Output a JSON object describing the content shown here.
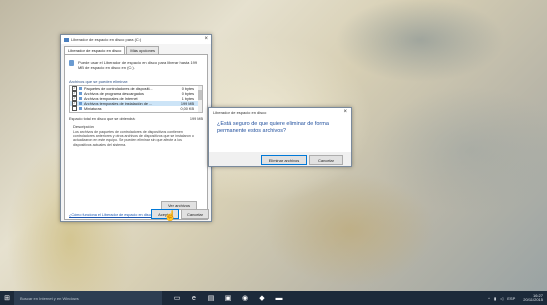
{
  "cleanup_window": {
    "title": "Liberador de espacio en disco para (C:)",
    "tabs": [
      "Liberador de espacio en disco",
      "Más opciones"
    ],
    "drive_text": "Puede usar el Liberador de espacio en disco para liberar hasta 199 MB de espacio en disco en (C:).",
    "section_label": "Archivos que se pueden eliminar:",
    "items": [
      {
        "name": "Paquetes de controladores de dispositi...",
        "size": "0 bytes"
      },
      {
        "name": "Archivos de programa descargados",
        "size": "0 bytes"
      },
      {
        "name": "Archivos temporales de Internet",
        "size": "1 bytes"
      },
      {
        "name": "Archivos temporales de instalación de ...",
        "size": "199 MB"
      },
      {
        "name": "Miniaturas",
        "size": "0,00 KB"
      }
    ],
    "total_label": "Espacio total en disco que se obtendrá:",
    "total_value": "199 MB",
    "desc_title": "Descripción",
    "description": "Los archivos de paquetes de controladores de dispositivos contienen controladores anteriores y otros archivos de dispositivos que se instalaron o actualizaron en este equipo. Se pueden eliminar sin que afecte a los dispositivos actuales del sistema.",
    "view_files_label": "Ver archivos",
    "link": "¿Cómo funciona el Liberador de espacio en disco?",
    "ok_label": "Aceptar",
    "cancel_label": "Cancelar"
  },
  "confirm_dialog": {
    "title": "Liberador de espacio en disco",
    "message": "¿Está seguro de que quiere eliminar de forma permanente estos archivos?",
    "delete_label": "Eliminar archivos",
    "cancel_label": "Cancelar"
  },
  "taskbar": {
    "search_placeholder": "Buscar en Internet y en Windows",
    "time": "16:27",
    "date": "20/11/2015",
    "language": "ESP"
  },
  "colors": {
    "taskbar": "#1c2a3a",
    "accent": "#0078d7",
    "link": "#1a56b3"
  }
}
